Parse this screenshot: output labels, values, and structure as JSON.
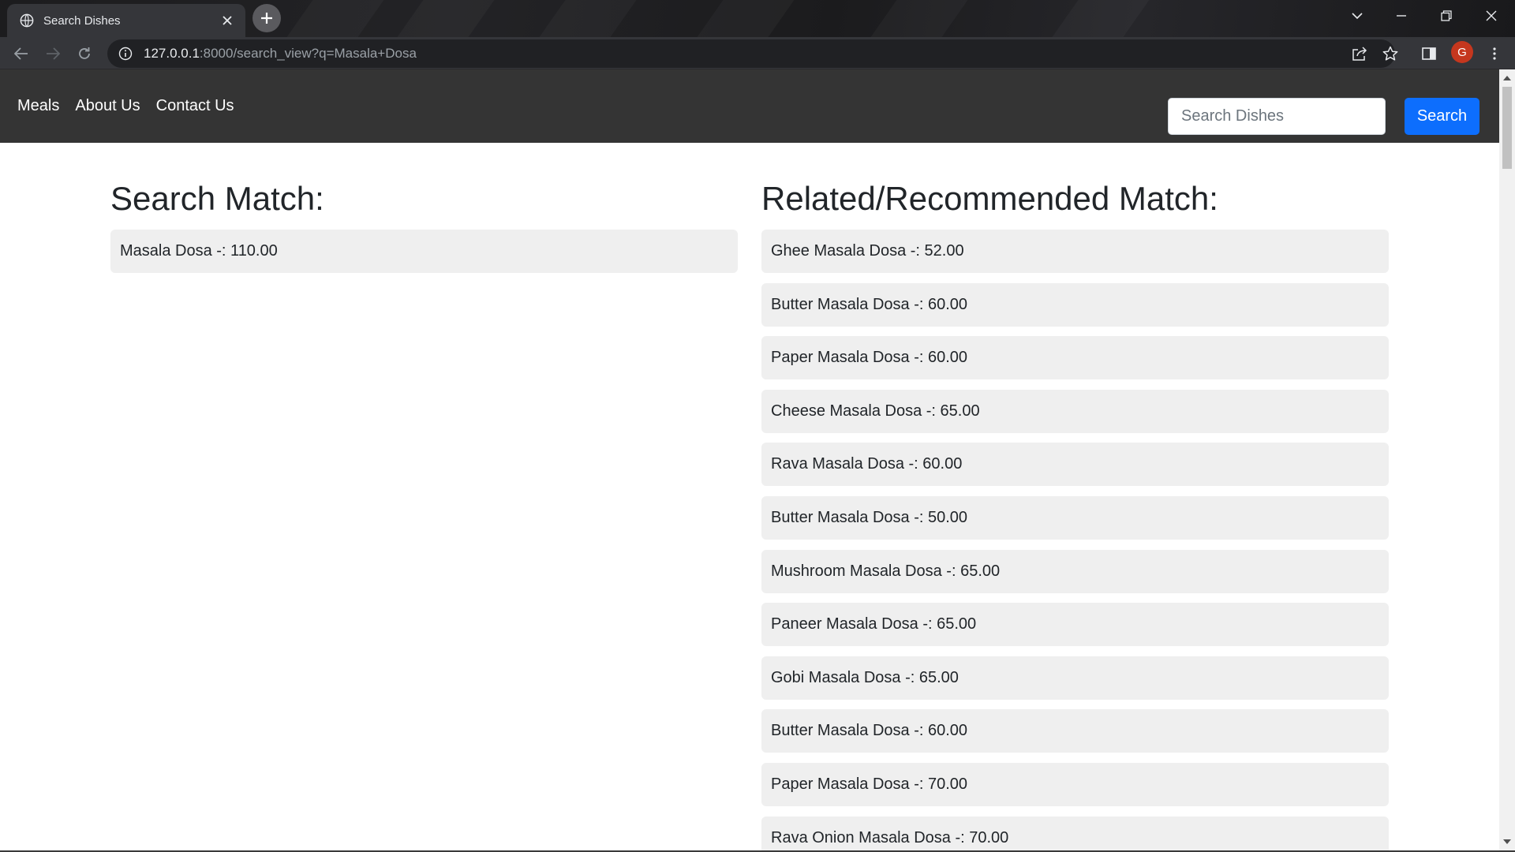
{
  "browser": {
    "tab_title": "Search Dishes",
    "url_host": "127.0.0.1",
    "url_rest": ":8000/search_view?q=Masala+Dosa",
    "profile_initial": "G"
  },
  "navbar": {
    "links": [
      "Meals",
      "About Us",
      "Contact Us"
    ],
    "search_placeholder": "Search Dishes",
    "search_button": "Search"
  },
  "search_match": {
    "heading": "Search Match:",
    "items": [
      "Masala Dosa -: 110.00"
    ]
  },
  "related": {
    "heading": "Related/Recommended Match:",
    "items": [
      "Ghee Masala Dosa -: 52.00",
      "Butter Masala Dosa -: 60.00",
      "Paper Masala Dosa -: 60.00",
      "Cheese Masala Dosa -: 65.00",
      "Rava Masala Dosa -: 60.00",
      "Butter Masala Dosa -: 50.00",
      "Mushroom Masala Dosa -: 65.00",
      "Paneer Masala Dosa -: 65.00",
      "Gobi Masala Dosa -: 65.00",
      "Butter Masala Dosa -: 60.00",
      "Paper Masala Dosa -: 70.00",
      "Rava Onion Masala Dosa -: 70.00"
    ]
  },
  "colors": {
    "navbar_bg": "#343434",
    "primary_button": "#0d6efd",
    "item_bg": "#efefef"
  },
  "icons": [
    "globe-icon",
    "close-icon",
    "plus-icon",
    "back-icon",
    "forward-icon",
    "reload-icon",
    "info-icon",
    "share-icon",
    "star-icon",
    "sidepanel-icon",
    "more-icon",
    "chevron-down-icon",
    "minimize-icon",
    "restore-icon",
    "window-close-icon"
  ]
}
